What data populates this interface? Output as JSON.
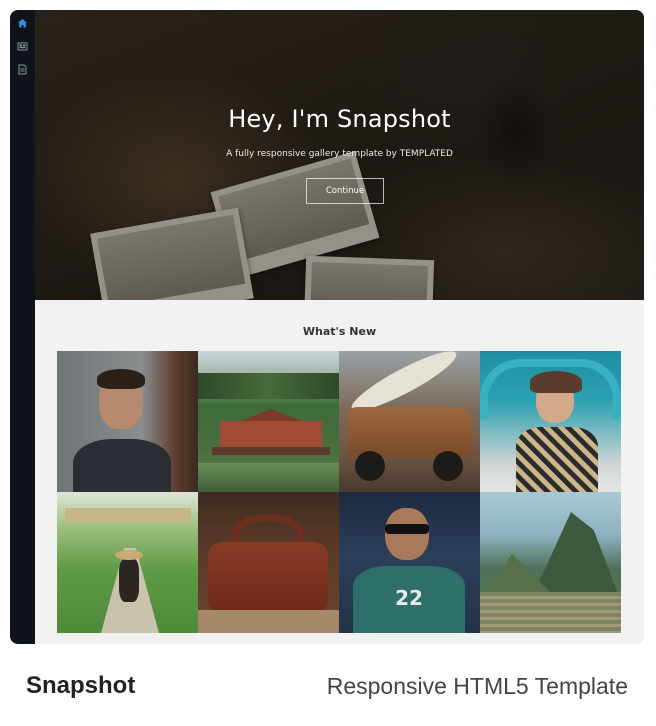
{
  "hero": {
    "title": "Hey, I'm Snapshot",
    "subtitle": "A fully responsive gallery template by TEMPLATED",
    "continue_label": "Continue"
  },
  "side_nav": {
    "items": [
      {
        "icon": "home-icon",
        "active": true
      },
      {
        "icon": "gallery-icon",
        "active": false
      },
      {
        "icon": "document-icon",
        "active": false
      }
    ]
  },
  "whats_new": {
    "title": "What's New",
    "thumbnails": [
      {
        "subject": "portrait-man"
      },
      {
        "subject": "pagoda-temple"
      },
      {
        "subject": "rusty-truck-surfboard"
      },
      {
        "subject": "woman-in-car"
      },
      {
        "subject": "woman-walking-path"
      },
      {
        "subject": "leather-bag"
      },
      {
        "subject": "man-sunglasses"
      },
      {
        "subject": "machu-picchu"
      }
    ]
  },
  "caption": {
    "title": "Snapshot",
    "subtitle": "Responsive HTML5 Template"
  },
  "colors": {
    "sidebar": "#0f141a",
    "accent": "#3b8eea",
    "section_bg": "#f2f2f2"
  }
}
